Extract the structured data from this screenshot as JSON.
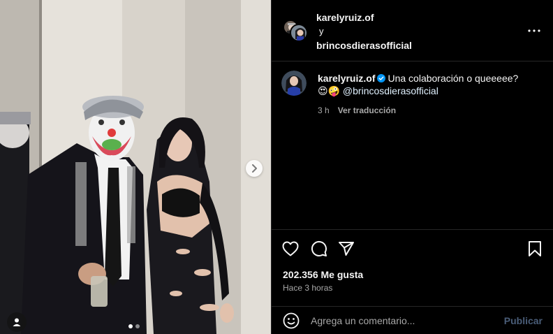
{
  "post": {
    "media": {
      "image_alt": "photo",
      "carousel_total": 2,
      "carousel_active": 1,
      "next_icon": "chevron-right-icon",
      "tag_icon": "user-tag-icon"
    }
  },
  "header": {
    "author": "karelyruiz.of",
    "conjunction": "y",
    "collaborator": "brincosdierasofficial",
    "more_icon": "more-horizontal-icon"
  },
  "caption": {
    "username": "karelyruiz.of",
    "verified": true,
    "text": "Una colaboración o queeeee?",
    "emojis": "😍🤪",
    "mention": "@brincosdierasofficial",
    "time": "3 h",
    "translate_label": "Ver traducción"
  },
  "actions": {
    "icons": [
      "heart-icon",
      "comment-icon",
      "share-icon",
      "bookmark-icon"
    ],
    "likes": "202.356 Me gusta",
    "posted": "Hace 3 horas"
  },
  "comment": {
    "placeholder": "Agrega un comentario...",
    "publish_label": "Publicar",
    "emoji_icon": "smiley-icon"
  },
  "colors": {
    "background": "#000000",
    "text": "#f5f5f5",
    "secondary_text": "#a8a8a8",
    "verified": "#0095f6",
    "publish_disabled": "#4a5d78",
    "divider": "#262626"
  }
}
